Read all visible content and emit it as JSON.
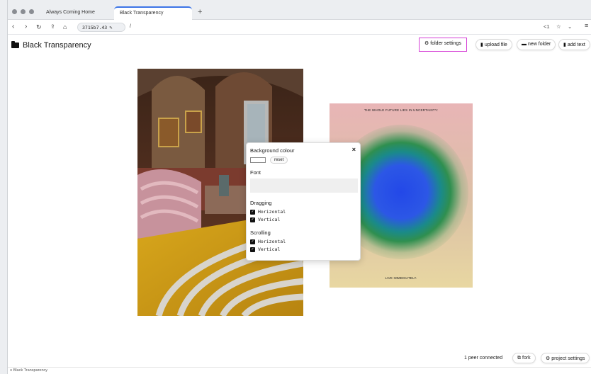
{
  "browser": {
    "tabs": [
      {
        "label": "Always Coming Home",
        "active": false
      },
      {
        "label": "Black Transparency",
        "active": true
      }
    ],
    "new_tab": "+",
    "url_id": "3715b7.43",
    "url_path": "/",
    "nav_right_count": "1"
  },
  "page": {
    "folder_title": "Black Transparency",
    "toolbar": {
      "folder_settings": "folder settings",
      "upload_file": "upload file",
      "new_folder": "new folder",
      "add_text": "add text"
    },
    "poster": {
      "top_text": "THE WHOLE FUTURE LIES IN UNCERTAINTY:",
      "bottom_text": "LIVE IMMEDIATELY."
    },
    "settings_popup": {
      "background_colour_label": "Background colour",
      "reset_label": "reset",
      "font_label": "Font",
      "dragging_label": "Dragging",
      "scrolling_label": "Scrolling",
      "dragging_options": [
        {
          "label": "Horizontal",
          "checked": true
        },
        {
          "label": "Vertical",
          "checked": true
        }
      ],
      "scrolling_options": [
        {
          "label": "Horizontal",
          "checked": true
        },
        {
          "label": "Vertical",
          "checked": true
        }
      ],
      "close": "×"
    },
    "footer": {
      "peer_status": "1 peer connected",
      "fork_label": "fork",
      "project_settings_label": "project settings"
    },
    "statusbar_text": "Black Transparency"
  },
  "colors": {
    "accent_tab": "#3b73e6",
    "highlight_border": "#d53fd6"
  }
}
